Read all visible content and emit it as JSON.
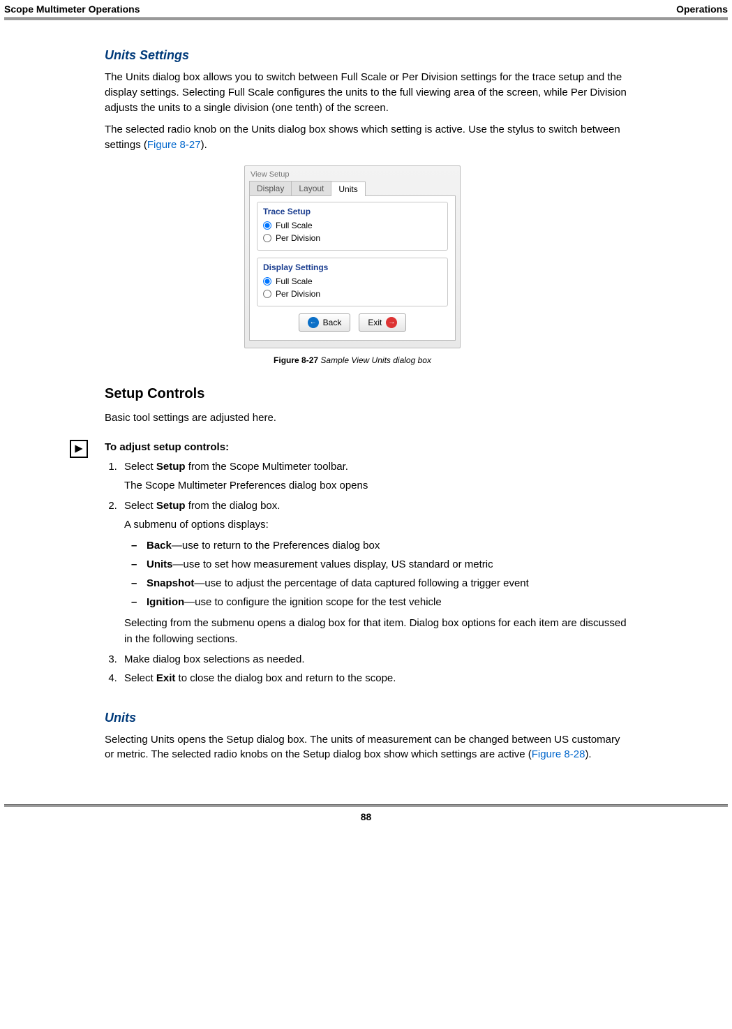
{
  "header": {
    "left": "Scope Multimeter Operations",
    "right": "Operations"
  },
  "units_settings": {
    "title": "Units Settings",
    "p1": "The Units dialog box allows you to switch between Full Scale or Per Division settings for the trace setup and the display settings. Selecting Full Scale configures the units to the full viewing area of the screen, while Per Division adjusts the units to a single division (one tenth) of the screen.",
    "p2_a": "The selected radio knob on the Units dialog box shows which setting is active. Use the stylus to switch between settings (",
    "p2_link": "Figure 8-27",
    "p2_b": ")."
  },
  "dialog": {
    "window_title": "View Setup",
    "tabs": {
      "display": "Display",
      "layout": "Layout",
      "units": "Units"
    },
    "trace_setup": {
      "legend": "Trace Setup",
      "opt1": "Full Scale",
      "opt2": "Per Division"
    },
    "display_settings": {
      "legend": "Display Settings",
      "opt1": "Full Scale",
      "opt2": "Per Division"
    },
    "buttons": {
      "back": "Back",
      "exit": "Exit"
    }
  },
  "figcap": {
    "bold": "Figure 8-27",
    "ital": " Sample View Units dialog box"
  },
  "setup_controls": {
    "title": "Setup Controls",
    "intro": "Basic tool settings are adjusted here.",
    "proc_title": "To adjust setup controls:",
    "step1_a": "Select ",
    "step1_b": "Setup",
    "step1_c": " from the Scope Multimeter toolbar.",
    "step1_sub": "The Scope Multimeter Preferences dialog box opens",
    "step2_a": "Select ",
    "step2_b": "Setup",
    "step2_c": " from the dialog box.",
    "step2_sub": "A submenu of options displays:",
    "opts": {
      "back_b": "Back",
      "back_t": "—use to return to the Preferences dialog box",
      "units_b": "Units",
      "units_t": "—use to set how measurement values display, US standard or metric",
      "snap_b": "Snapshot",
      "snap_t": "—use to adjust the percentage of data captured following a trigger event",
      "ign_b": "Ignition",
      "ign_t": "—use to configure the ignition scope for the test vehicle"
    },
    "step2_tail": "Selecting from the submenu opens a dialog box for that item. Dialog box options for each item are discussed in the following sections.",
    "step3": "Make dialog box selections as needed.",
    "step4_a": "Select ",
    "step4_b": "Exit",
    "step4_c": " to close the dialog box and return to the scope."
  },
  "units": {
    "title": "Units",
    "p_a": "Selecting Units opens the Setup dialog box. The units of measurement can be changed between US customary or metric. The selected radio knobs on the Setup dialog box show which settings are active (",
    "p_link": "Figure 8-28",
    "p_b": ")."
  },
  "page_number": "88"
}
